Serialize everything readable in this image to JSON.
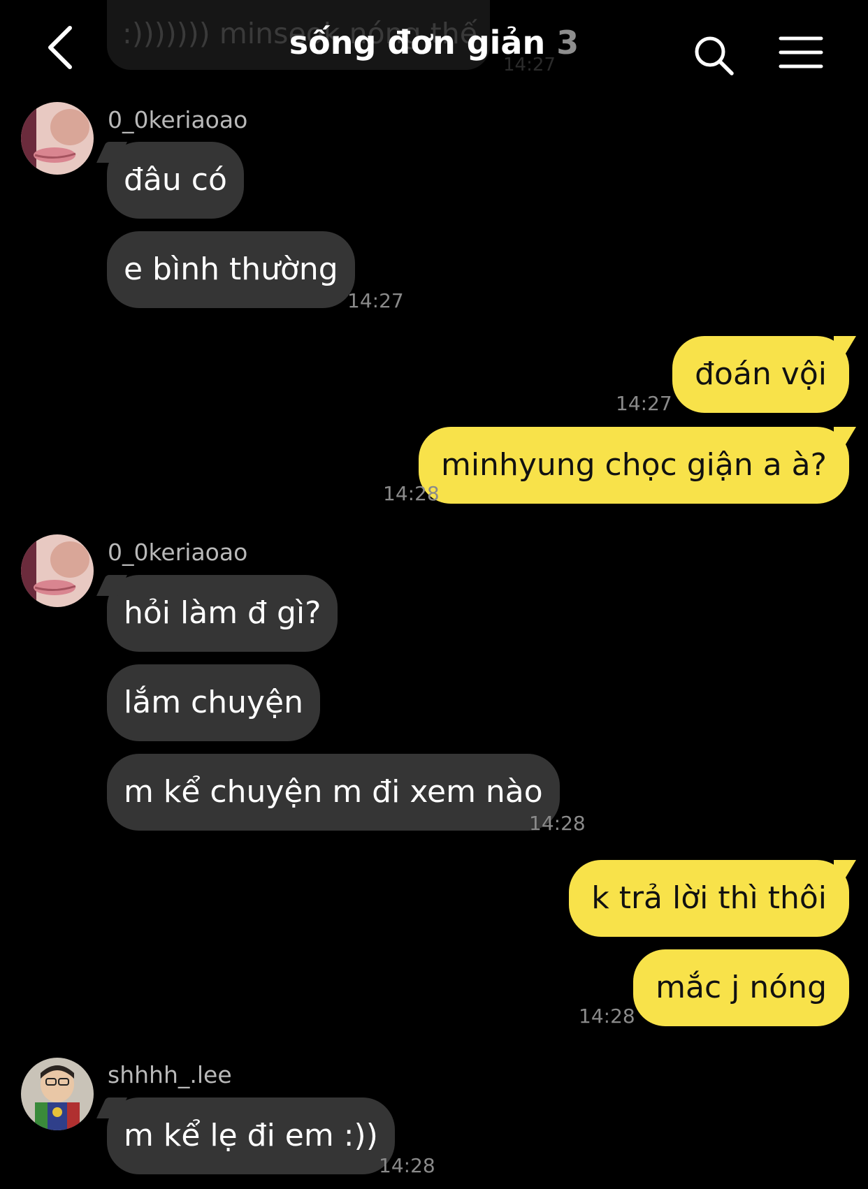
{
  "header": {
    "title": "sống đơn giản",
    "member_count": "3",
    "back_icon": "chevron-left-icon",
    "search_icon": "search-icon",
    "menu_icon": "hamburger-menu-icon"
  },
  "preview": {
    "text": ":))))))) minseok nóng thế",
    "time": "14:27"
  },
  "colors": {
    "background": "#000000",
    "incoming_bubble": "#353535",
    "outgoing_bubble": "#f8e24a",
    "timestamp": "#8a8a8a"
  },
  "groups": [
    {
      "sender": "0_0keriaoao",
      "messages": [
        "đâu có",
        "e bình thường"
      ],
      "time": "14:27"
    },
    {
      "sender": "me",
      "messages": [
        "đoán vội"
      ],
      "time": "14:27"
    },
    {
      "sender": "me",
      "messages": [
        "minhyung chọc giận a à?"
      ],
      "time": "14:28"
    },
    {
      "sender": "0_0keriaoao",
      "messages": [
        "hỏi làm đ gì?",
        "lắm chuyện",
        "m kể chuyện m đi xem nào"
      ],
      "time": "14:28"
    },
    {
      "sender": "me",
      "messages": [
        "k trả lời thì thôi",
        "mắc j nóng"
      ],
      "time": "14:28"
    },
    {
      "sender": "shhhh_.lee",
      "messages": [
        "m kể lẹ đi em :))"
      ],
      "time": "14:28"
    }
  ]
}
